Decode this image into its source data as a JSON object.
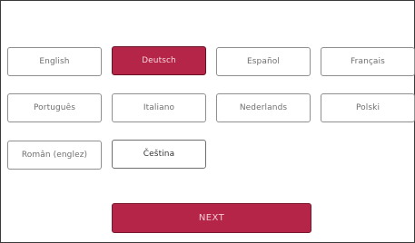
{
  "languages": [
    {
      "label": "English"
    },
    {
      "label": "Deutsch"
    },
    {
      "label": "Español"
    },
    {
      "label": "Français"
    },
    {
      "label": "Português"
    },
    {
      "label": "Italiano"
    },
    {
      "label": "Nederlands"
    },
    {
      "label": "Polski"
    },
    {
      "label": "Român (englez)"
    },
    {
      "label": "Čeština"
    }
  ],
  "selected_language": "Deutsch",
  "next_button": {
    "label": "NEXT"
  },
  "colors": {
    "accent": "#b52547",
    "button_border": "#8f8f8f",
    "button_text": "#6f6f6f",
    "background": "#ffffff"
  }
}
